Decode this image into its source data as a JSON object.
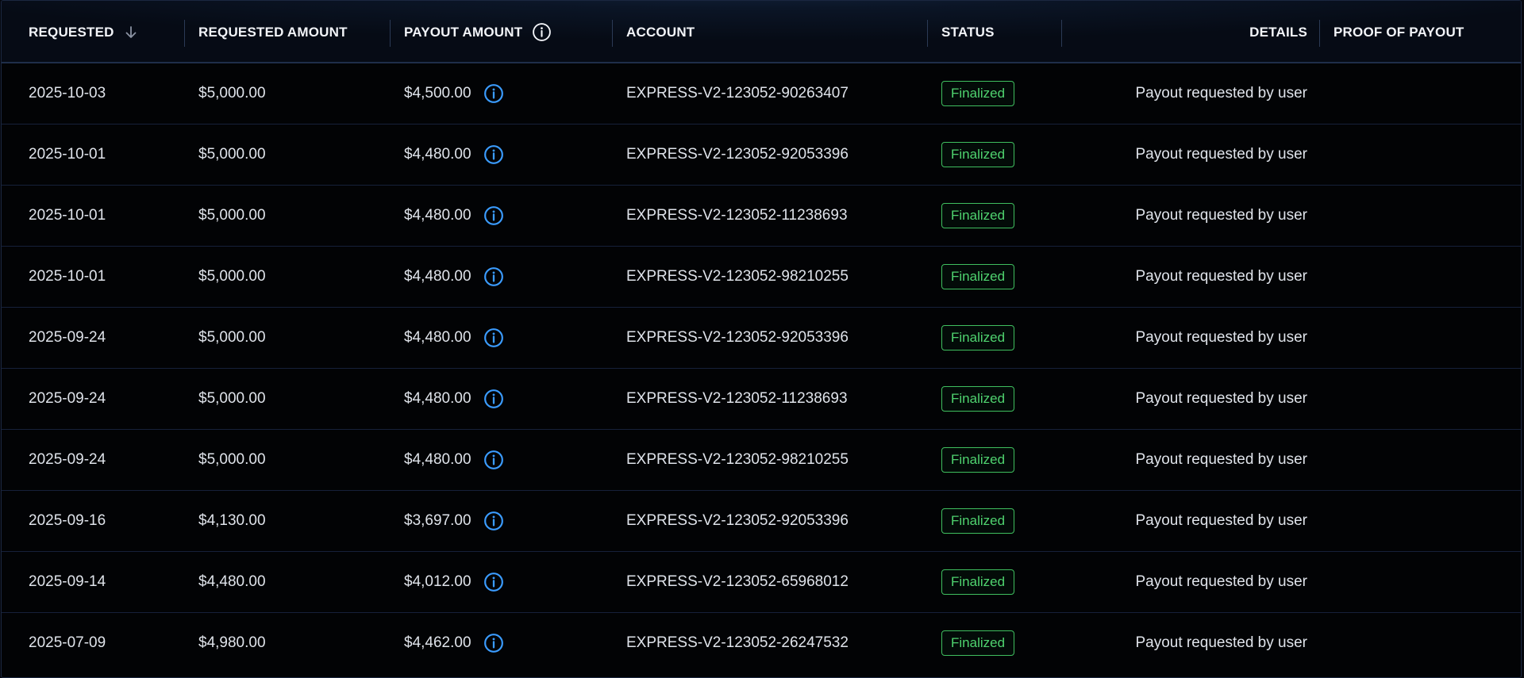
{
  "colors": {
    "accent_info": "#3b9cff",
    "status_finalized": "#4fd36f",
    "background": "#020305"
  },
  "table": {
    "headers": {
      "requested": "REQUESTED",
      "requested_amount": "REQUESTED AMOUNT",
      "payout_amount": "PAYOUT AMOUNT",
      "account": "ACCOUNT",
      "status": "STATUS",
      "details": "DETAILS",
      "proof_of_payout": "PROOF OF PAYOUT"
    },
    "sort": {
      "column": "requested",
      "direction": "descending",
      "icon": "arrow-down-icon"
    },
    "rows": [
      {
        "requested": "2025-10-03",
        "requested_amount": "$5,000.00",
        "payout_amount": "$4,500.00",
        "account": "EXPRESS-V2-123052-90263407",
        "status": "Finalized",
        "details": "Payout requested by user"
      },
      {
        "requested": "2025-10-01",
        "requested_amount": "$5,000.00",
        "payout_amount": "$4,480.00",
        "account": "EXPRESS-V2-123052-92053396",
        "status": "Finalized",
        "details": "Payout requested by user"
      },
      {
        "requested": "2025-10-01",
        "requested_amount": "$5,000.00",
        "payout_amount": "$4,480.00",
        "account": "EXPRESS-V2-123052-11238693",
        "status": "Finalized",
        "details": "Payout requested by user"
      },
      {
        "requested": "2025-10-01",
        "requested_amount": "$5,000.00",
        "payout_amount": "$4,480.00",
        "account": "EXPRESS-V2-123052-98210255",
        "status": "Finalized",
        "details": "Payout requested by user"
      },
      {
        "requested": "2025-09-24",
        "requested_amount": "$5,000.00",
        "payout_amount": "$4,480.00",
        "account": "EXPRESS-V2-123052-92053396",
        "status": "Finalized",
        "details": "Payout requested by user"
      },
      {
        "requested": "2025-09-24",
        "requested_amount": "$5,000.00",
        "payout_amount": "$4,480.00",
        "account": "EXPRESS-V2-123052-11238693",
        "status": "Finalized",
        "details": "Payout requested by user"
      },
      {
        "requested": "2025-09-24",
        "requested_amount": "$5,000.00",
        "payout_amount": "$4,480.00",
        "account": "EXPRESS-V2-123052-98210255",
        "status": "Finalized",
        "details": "Payout requested by user"
      },
      {
        "requested": "2025-09-16",
        "requested_amount": "$4,130.00",
        "payout_amount": "$3,697.00",
        "account": "EXPRESS-V2-123052-92053396",
        "status": "Finalized",
        "details": "Payout requested by user"
      },
      {
        "requested": "2025-09-14",
        "requested_amount": "$4,480.00",
        "payout_amount": "$4,012.00",
        "account": "EXPRESS-V2-123052-65968012",
        "status": "Finalized",
        "details": "Payout requested by user"
      },
      {
        "requested": "2025-07-09",
        "requested_amount": "$4,980.00",
        "payout_amount": "$4,462.00",
        "account": "EXPRESS-V2-123052-26247532",
        "status": "Finalized",
        "details": "Payout requested by user"
      }
    ]
  }
}
